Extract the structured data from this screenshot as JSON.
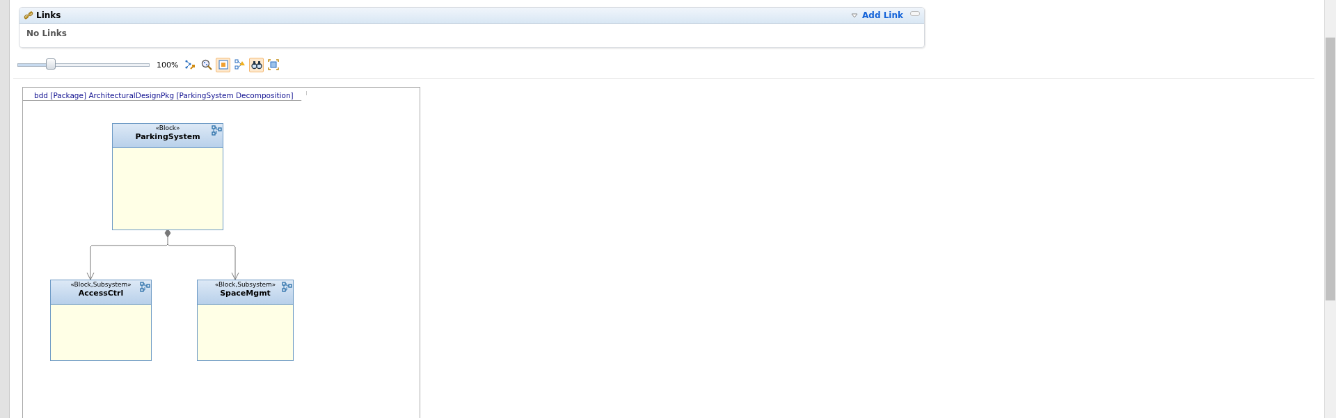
{
  "links_panel": {
    "title": "Links",
    "add_link": "Add Link",
    "empty_text": "No Links"
  },
  "toolbar": {
    "zoom_slider": {
      "level": 0.26
    },
    "zoom_reading": "100%",
    "tools": [
      {
        "selected": false
      },
      {
        "selected": false
      },
      {
        "selected": true
      },
      {
        "selected": false
      },
      {
        "selected": true
      },
      {
        "selected": false
      }
    ]
  },
  "diagram": {
    "frame_title": "bdd [Package] ArchitecturalDesignPkg [ParkingSystem Decomposition]",
    "blocks": [
      {
        "stereotype": "«Block»",
        "name": "ParkingSystem"
      },
      {
        "stereotype": "«Block,Subsystem»",
        "name": "AccessCtrl"
      },
      {
        "stereotype": "«Block,Subsystem»",
        "name": "SpaceMgmt"
      }
    ]
  }
}
